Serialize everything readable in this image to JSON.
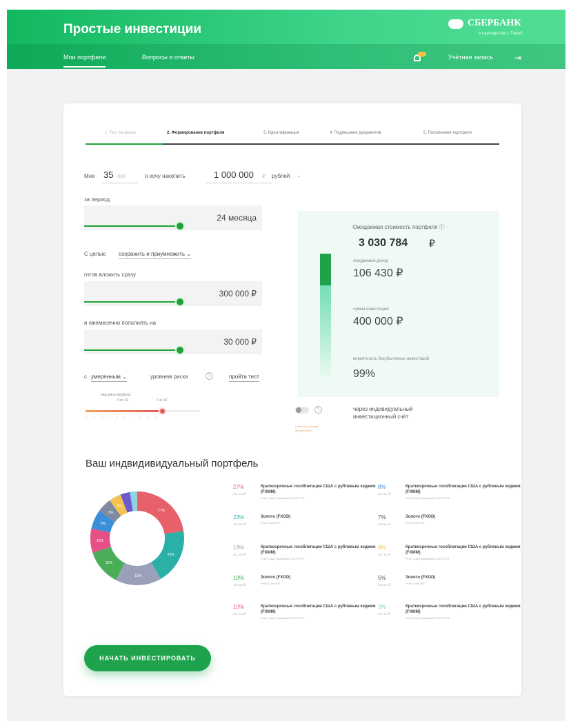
{
  "header": {
    "title": "Простые инвестиции",
    "bank_name": "СБЕРБАНК",
    "bank_sub": "в партнерстве с Tinkoff",
    "nav": [
      "Мои портфели",
      "Вопросы и ответы"
    ],
    "account": "Учётная запись",
    "logout_icon": "logout-icon",
    "bell_icon": "bell-icon"
  },
  "steps": [
    {
      "label": "1. Тест на риски",
      "state": "done"
    },
    {
      "label": "2. Формирование портфеля",
      "state": "current"
    },
    {
      "label": "3. Идентификация",
      "state": "todo"
    },
    {
      "label": "4. Подписание документов",
      "state": "todo"
    },
    {
      "label": "5. Пополнение портфеля",
      "state": "todo"
    }
  ],
  "form": {
    "prefix": "Мне",
    "age": "35",
    "age_unit": "лет",
    "want": "я хочу накопить",
    "amount": "1 000 000",
    "amount_currency": "₽",
    "currency_select": "рублей",
    "period_label": "за период",
    "period_value": "24 месяца",
    "goal_prefix": "С целью",
    "goal_value": "сохранить и приумножить",
    "initial_label": "готов вложить сразу",
    "initial_value": "300 000 ₽",
    "monthly_label": "и ежемесячно пополнять на",
    "monthly_value": "30 000 ₽",
    "risk_prefix": "с",
    "risk_value": "умеренным",
    "risk_suffix": "уровнем риска",
    "retake_test": "пройти тест",
    "risk_caption": "ваш риск-профиль",
    "risk_from": "4 из 10",
    "risk_to": "7 из 10",
    "risk_level": 7
  },
  "panel": {
    "title": "Ожидаемая стоимость портфеля",
    "total": "3 030 784",
    "total_currency": "₽",
    "income_label": "ожидаемый доход",
    "income_value": "106 430 ₽",
    "invest_label": "сумма инвестиций",
    "invest_value": "400 000 ₽",
    "prob_label": "вероятность безубыточных инвестиций",
    "prob_value": "99%"
  },
  "iis": {
    "text_line1": "через индивидуальный",
    "text_line2": "инвестиционный счёт",
    "note": "с вычетом дохода\nбез доп. ИИС"
  },
  "portfolio": {
    "title": "Ваш индвидивидуальный портфель",
    "cta": "НАЧАТЬ ИНВЕСТИРОВАТЬ",
    "items": [
      {
        "pct": "27%",
        "amt": "201 401 ₽",
        "name": "Краткосрочные гособлигации США с рублевым хеджем (FXMM)",
        "etf": "FinEx Cash Equivalents UCITS ETF",
        "color": "#e8606a"
      },
      {
        "pct": "23%",
        "amt": "150 564 ₽",
        "name": "Золото (FXGD)",
        "etf": "FinEx Gold ETF",
        "color": "#2bb0a8"
      },
      {
        "pct": "19%",
        "amt": "201 401 ₽",
        "name": "Краткосрочные гособлигации США с рублевым хеджем (FXMM)",
        "etf": "FinEx Cash Equivalents UCITS ETF",
        "color": "#9aa0b8"
      },
      {
        "pct": "19%",
        "amt": "150 564 ₽",
        "name": "Золото (FXGD)",
        "etf": "FinEx Gold ETF",
        "color": "#3fae5a"
      },
      {
        "pct": "10%",
        "amt": "201 401 ₽",
        "name": "Краткосрочные гособлигации США с рублевым хеджем (FXMM)",
        "etf": "FinEx Cash Equivalents UCITS ETF",
        "color": "#e84f86"
      },
      {
        "pct": "8%",
        "amt": "201 401 ₽",
        "name": "Краткосрочные гособлигации США с рублевым хеджем (FXMM)",
        "etf": "FinEx Cash Equivalents UCITS ETF",
        "color": "#3a8fd8"
      },
      {
        "pct": "7%",
        "amt": "150 564 ₽",
        "name": "Золото (FXGD)",
        "etf": "FinEx Gold ETF",
        "color": "#555555"
      },
      {
        "pct": "6%",
        "amt": "201 401 ₽",
        "name": "Краткосрочные гособлигации США с рублевым хеджем (FXMM)",
        "etf": "FinEx Cash Equivalents UCITS ETF",
        "color": "#f4c24f"
      },
      {
        "pct": "5%",
        "amt": "150 564 ₽",
        "name": "Золото (FXGD)",
        "etf": "FinEx Gold ETF",
        "color": "#555555"
      },
      {
        "pct": "3%",
        "amt": "201 401 ₽",
        "name": "Краткосрочные гособлигации США с рублевым хеджем (FXMM)",
        "etf": "FinEx Cash Equivalents UCITS ETF",
        "color": "#7ad0c6"
      }
    ]
  },
  "chart_data": {
    "type": "pie",
    "categories": [
      "27%",
      "23%",
      "19%",
      "15%",
      "10%",
      "8%",
      "6%",
      "5%",
      "4%",
      "3%"
    ],
    "values": [
      27,
      23,
      19,
      15,
      10,
      8,
      6,
      5,
      4,
      3
    ],
    "labels_shown": [
      "27%",
      "23%",
      "19%",
      "15%",
      "10%",
      "8%",
      "6%",
      "5%"
    ],
    "colors": [
      "#e8606a",
      "#2bb0a8",
      "#9aa0b8",
      "#4aae58",
      "#e84f86",
      "#3a8fd8",
      "#7d8aa0",
      "#f4c24f",
      "#6a5acd",
      "#8fd4e0"
    ]
  }
}
